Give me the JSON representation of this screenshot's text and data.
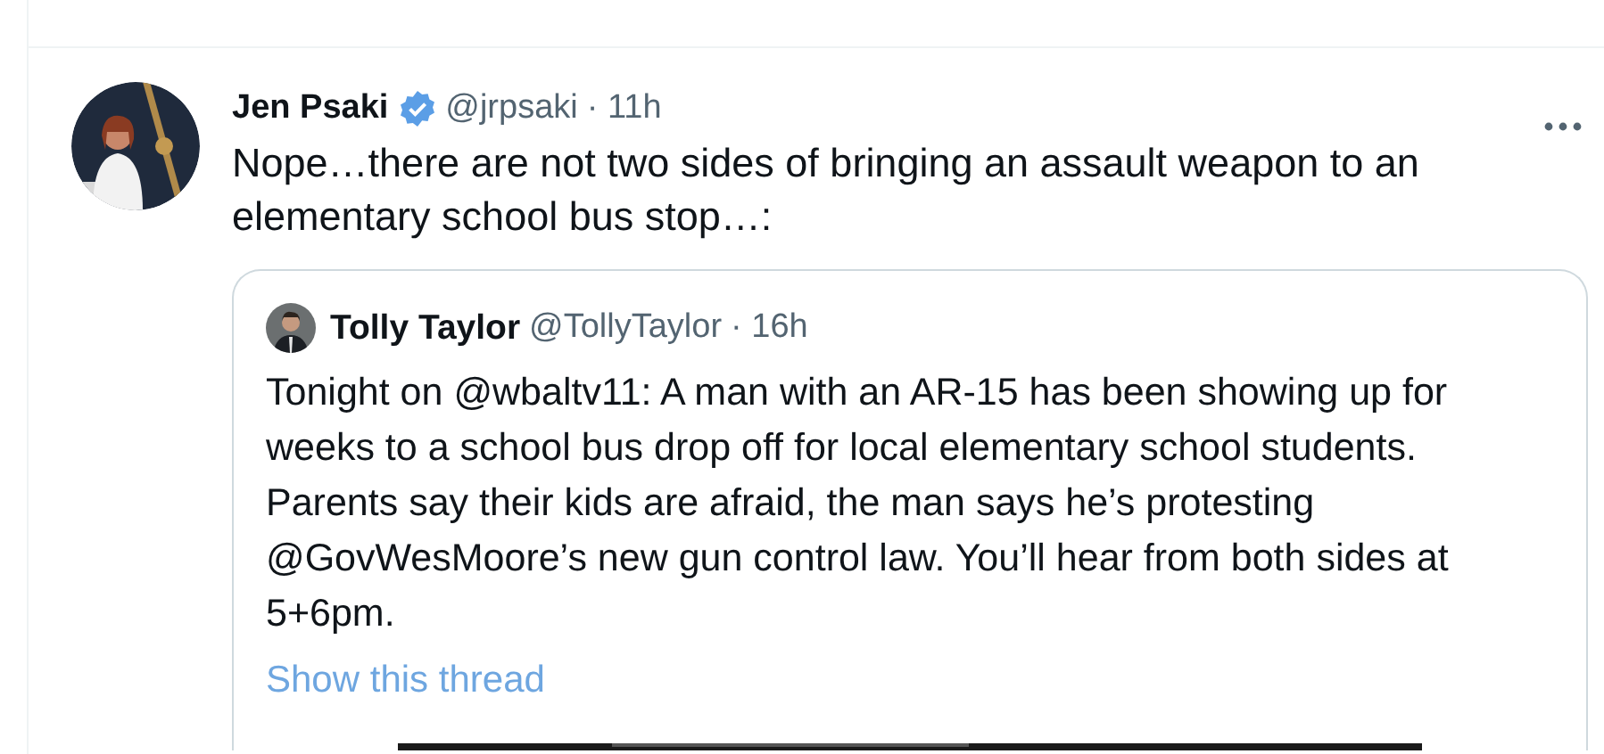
{
  "tweet": {
    "author": {
      "name": "Jen Psaki",
      "verified": true,
      "handle": "@jrpsaki",
      "time": "· 11h"
    },
    "text": "Nope…there are not two sides of bringing an assault weapon to an elementary school bus stop…:",
    "quote": {
      "author": {
        "name": "Tolly Taylor",
        "handle": "@TollyTaylor",
        "time": "· 16h"
      },
      "text": "Tonight on @wbaltv11: A man with an AR-15 has been showing up for weeks to a school bus drop off for local elementary school students. Parents say their kids are afraid, the man says he’s protesting @GovWesMoore’s new gun control law. You’ll hear from both sides at 5+6pm.",
      "thread_link": "Show this thread"
    }
  }
}
